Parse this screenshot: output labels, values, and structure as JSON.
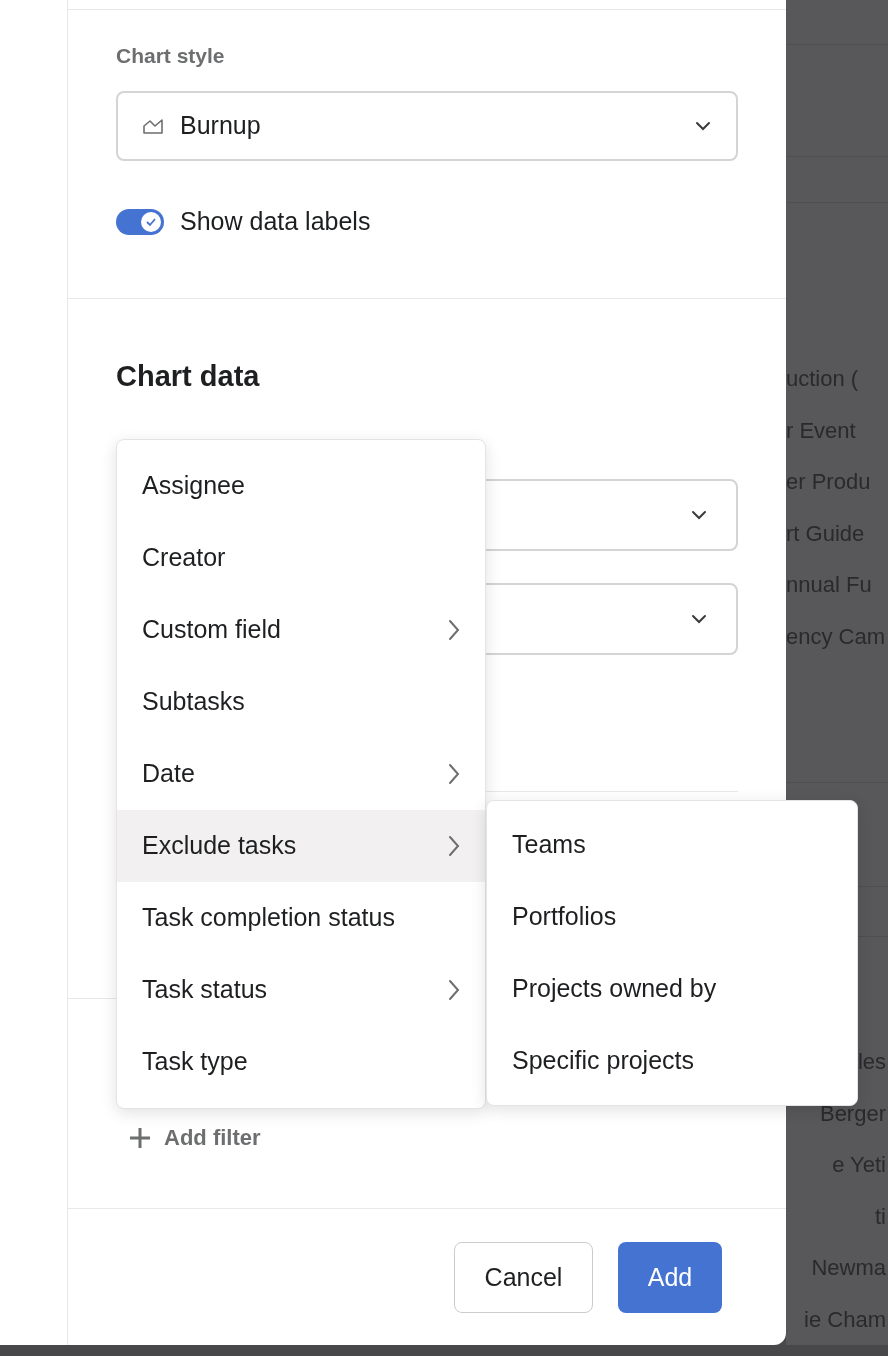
{
  "chart_style": {
    "label": "Chart style",
    "value": "Burnup"
  },
  "data_labels_toggle": {
    "label": "Show data labels",
    "on": true
  },
  "data_section": {
    "title": "Chart data"
  },
  "filter_menu": {
    "items": [
      {
        "label": "Assignee",
        "has_submenu": false,
        "selected": false
      },
      {
        "label": "Creator",
        "has_submenu": false,
        "selected": false
      },
      {
        "label": "Custom field",
        "has_submenu": true,
        "selected": false
      },
      {
        "label": "Subtasks",
        "has_submenu": false,
        "selected": false
      },
      {
        "label": "Date",
        "has_submenu": true,
        "selected": false
      },
      {
        "label": "Exclude tasks",
        "has_submenu": true,
        "selected": true
      },
      {
        "label": "Task completion status",
        "has_submenu": false,
        "selected": false
      },
      {
        "label": "Task status",
        "has_submenu": true,
        "selected": false
      },
      {
        "label": "Task type",
        "has_submenu": false,
        "selected": false
      }
    ]
  },
  "submenu": {
    "items": [
      "Teams",
      "Portfolios",
      "Projects owned by",
      "Specific projects"
    ]
  },
  "add_filter": "Add filter",
  "buttons": [
    {
      "label": "Cancel",
      "kind": "secondary"
    },
    {
      "label": "Add",
      "kind": "primary"
    }
  ],
  "background_list": {
    "top": [
      "uction (",
      "r Event",
      "er Produ",
      "rt Guide",
      "nnual Fu",
      "ency Cam"
    ],
    "bottom": [
      "les",
      "Berger",
      "e Yeti",
      "ti",
      "Newma",
      "ie Cham"
    ]
  }
}
